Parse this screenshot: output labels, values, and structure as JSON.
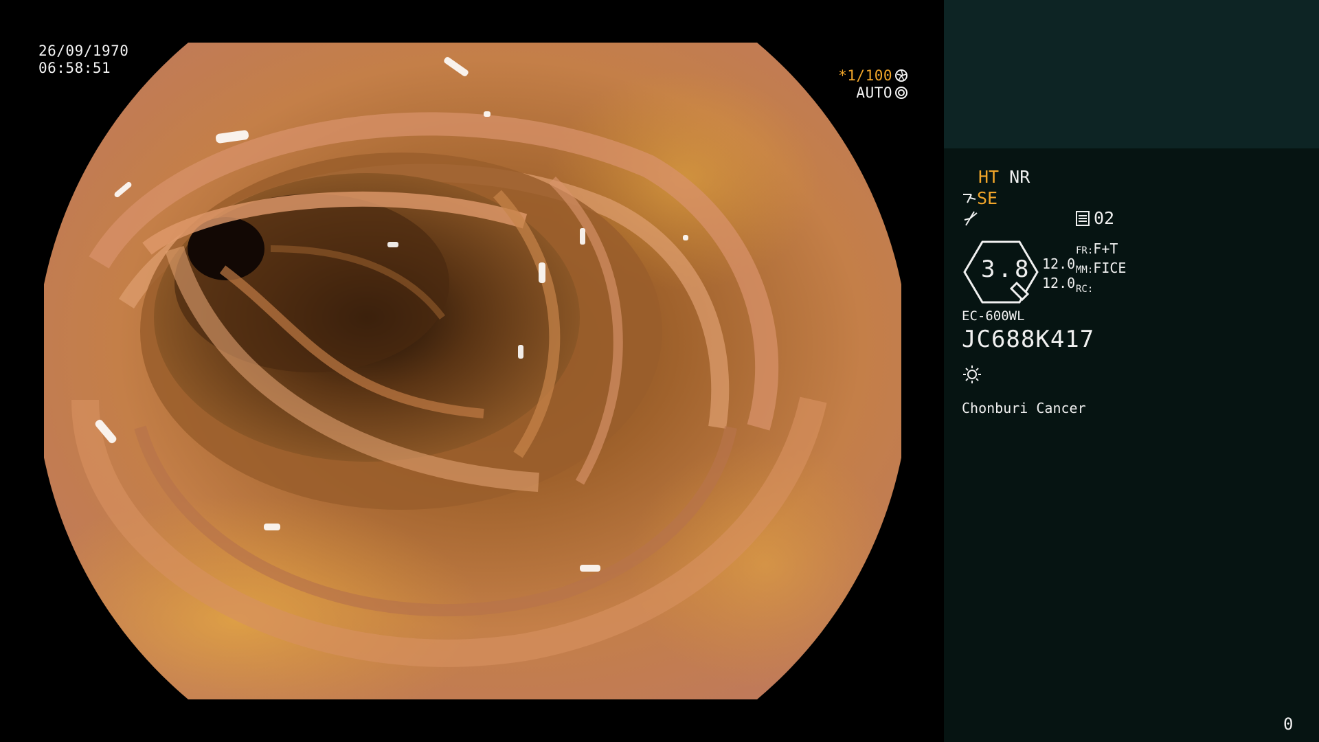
{
  "viewport": {
    "date": "26/09/1970",
    "time": "06:58:51",
    "shutter_speed": "*1/100",
    "iris_mode": "AUTO"
  },
  "panel": {
    "ht": "HT",
    "nr": "NR",
    "se": "SE",
    "memory": "02",
    "zoom": "3.8",
    "value_1": "12.0",
    "value_2": "12.0",
    "fr_label": "FR:",
    "fr_value": "F+T",
    "mm_label": "MM:",
    "mm_value": "FICE",
    "rc_label": "RC:",
    "scope_model": "EC-600WL",
    "scope_serial": "JC688K417",
    "institution": "Chonburi Cancer",
    "page": "0"
  },
  "icons": [
    "aperture-icon",
    "iris-icon",
    "scope-tip-icon",
    "wave-icon",
    "memory-icon",
    "zoom-lens-icon",
    "sun-icon"
  ],
  "colors": {
    "accent": "#f2a62a",
    "panel_bg": "#061412",
    "panel_top": "#0d2424",
    "text": "#f0f0f0"
  }
}
